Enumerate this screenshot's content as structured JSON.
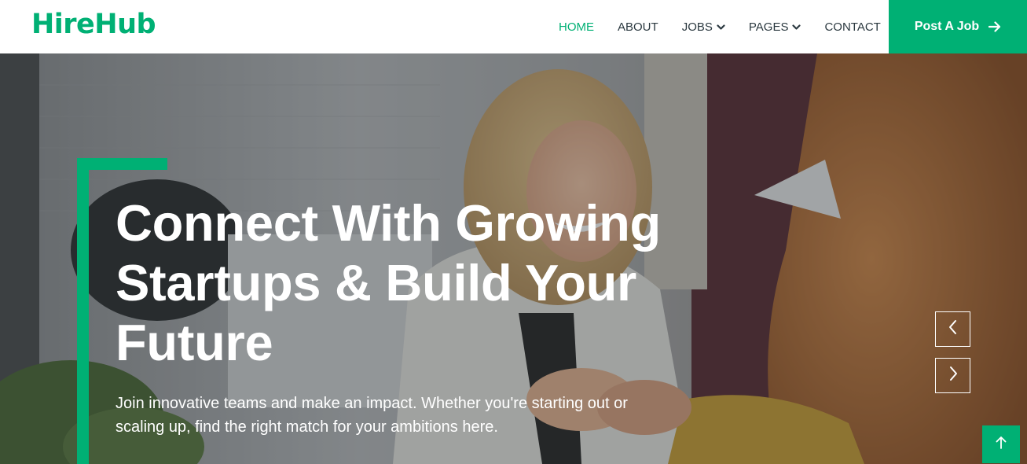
{
  "brand": {
    "name": "HireHub"
  },
  "nav": {
    "items": [
      {
        "label": "HOME",
        "active": true,
        "dropdown": false
      },
      {
        "label": "ABOUT",
        "active": false,
        "dropdown": false
      },
      {
        "label": "JOBS",
        "active": false,
        "dropdown": true
      },
      {
        "label": "PAGES",
        "active": false,
        "dropdown": true
      },
      {
        "label": "CONTACT",
        "active": false,
        "dropdown": false
      }
    ],
    "cta_label": "Post A Job",
    "cta_icon": "arrow-right-icon"
  },
  "hero": {
    "title_line1": "Connect With Growing",
    "title_line2": "Startups & Build Your",
    "title_line3": "Future",
    "subtitle_line1": "Join innovative teams and make an impact. Whether you're starting out or",
    "subtitle_line2": "scaling up, find the right match for your ambitions here.",
    "prev_icon": "chevron-left-icon",
    "next_icon": "chevron-right-icon"
  },
  "back_to_top_icon": "arrow-up-icon",
  "colors": {
    "accent": "#00b074",
    "nav_text": "#2b3940",
    "hero_text": "#ffffff"
  }
}
